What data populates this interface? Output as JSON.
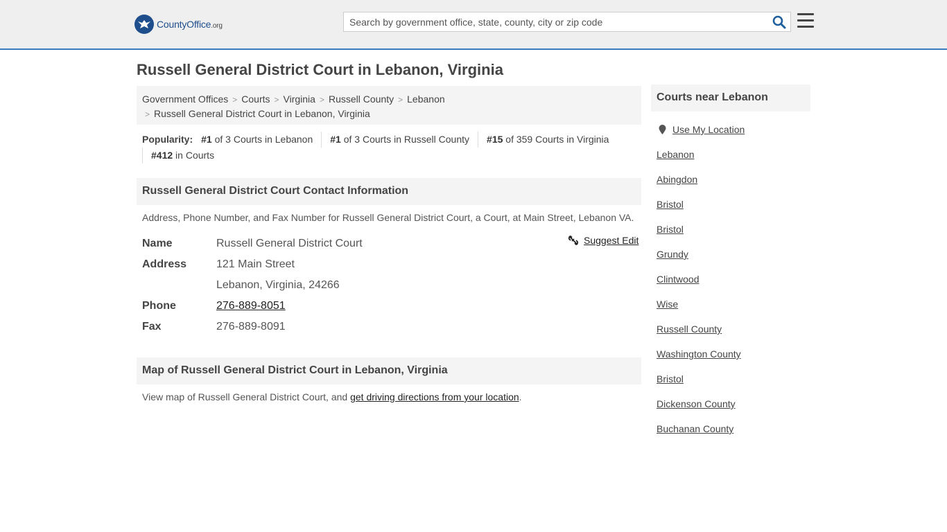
{
  "header": {
    "logo_brand": "CountyOffice",
    "logo_tld": ".org",
    "search_placeholder": "Search by government office, state, county, city or zip code"
  },
  "page_title": "Russell General District Court in Lebanon, Virginia",
  "breadcrumb": [
    "Government Offices",
    "Courts",
    "Virginia",
    "Russell County",
    "Lebanon",
    "Russell General District Court in Lebanon, Virginia"
  ],
  "popularity": {
    "label": "Popularity:",
    "items": [
      {
        "rank": "#1",
        "text": " of 3 Courts in Lebanon"
      },
      {
        "rank": "#1",
        "text": " of 3 Courts in Russell County"
      },
      {
        "rank": "#15",
        "text": " of 359 Courts in Virginia"
      },
      {
        "rank": "#412",
        "text": " in Courts"
      }
    ]
  },
  "contact": {
    "heading": "Russell General District Court Contact Information",
    "description": "Address, Phone Number, and Fax Number for Russell General District Court, a Court, at Main Street, Lebanon VA.",
    "suggest_edit": "Suggest Edit",
    "name_label": "Name",
    "name": "Russell General District Court",
    "address_label": "Address",
    "address_line1": "121 Main Street",
    "address_line2": "Lebanon, Virginia, 24266",
    "phone_label": "Phone",
    "phone": "276-889-8051",
    "fax_label": "Fax",
    "fax": "276-889-8091"
  },
  "map": {
    "heading": "Map of Russell General District Court in Lebanon, Virginia",
    "text_before": "View map of Russell General District Court, and ",
    "link": "get driving directions from your location",
    "text_after": "."
  },
  "sidebar": {
    "heading": "Courts near Lebanon",
    "use_location": "Use My Location",
    "items": [
      "Lebanon",
      "Abingdon",
      "Bristol",
      "Bristol",
      "Grundy",
      "Clintwood",
      "Wise",
      "Russell County",
      "Washington County",
      "Bristol",
      "Dickenson County",
      "Buchanan County"
    ]
  },
  "colors": {
    "accent": "#3a7bbf",
    "brand": "#1f4e8c",
    "panel_bg": "#f4f4f4"
  }
}
